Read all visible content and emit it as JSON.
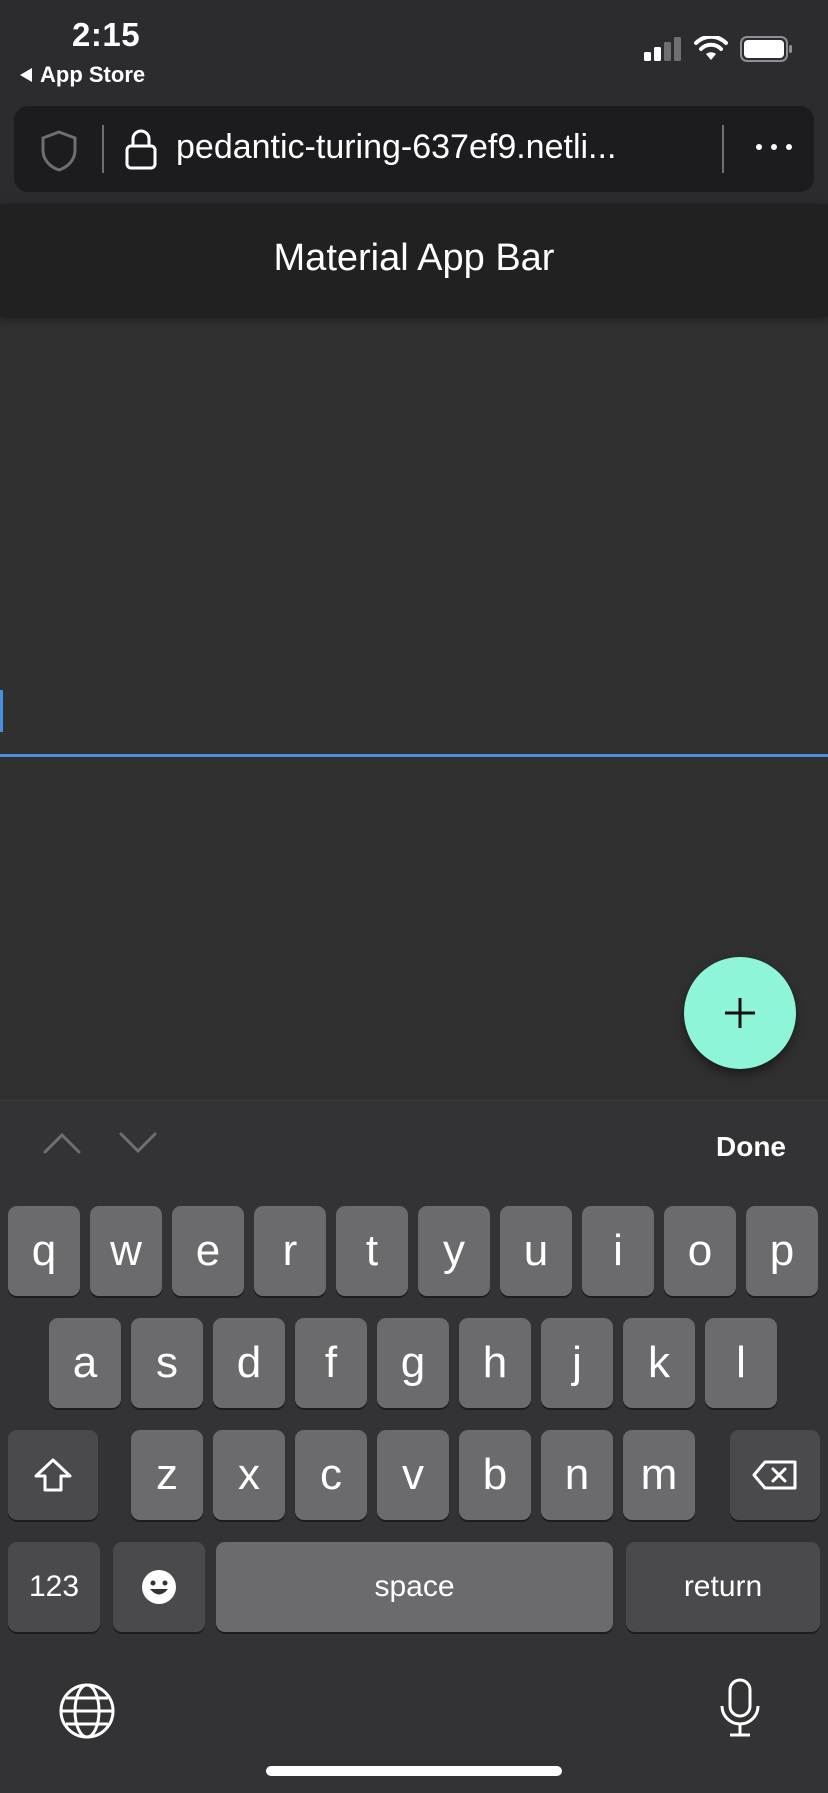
{
  "status_bar": {
    "time": "2:15",
    "back_app": "App Store",
    "icons": [
      "signal-icon",
      "wifi-icon",
      "battery-icon"
    ]
  },
  "browser": {
    "url": "pedantic-turing-637ef9.netli...",
    "icons": [
      "shield-icon",
      "lock-icon",
      "more-icon"
    ]
  },
  "app_bar": {
    "title": "Material App Bar"
  },
  "fab": {
    "icon": "plus-icon",
    "color": "#8ef5d8"
  },
  "keyboard": {
    "done_label": "Done",
    "row1": [
      "q",
      "w",
      "e",
      "r",
      "t",
      "y",
      "u",
      "i",
      "o",
      "p"
    ],
    "row2": [
      "a",
      "s",
      "d",
      "f",
      "g",
      "h",
      "j",
      "k",
      "l"
    ],
    "row3": [
      "z",
      "x",
      "c",
      "v",
      "b",
      "n",
      "m"
    ],
    "numbers_label": "123",
    "space_label": "space",
    "return_label": "return"
  },
  "colors": {
    "background": "#303030",
    "app_bar": "#212121",
    "accent": "#4a90e2"
  }
}
